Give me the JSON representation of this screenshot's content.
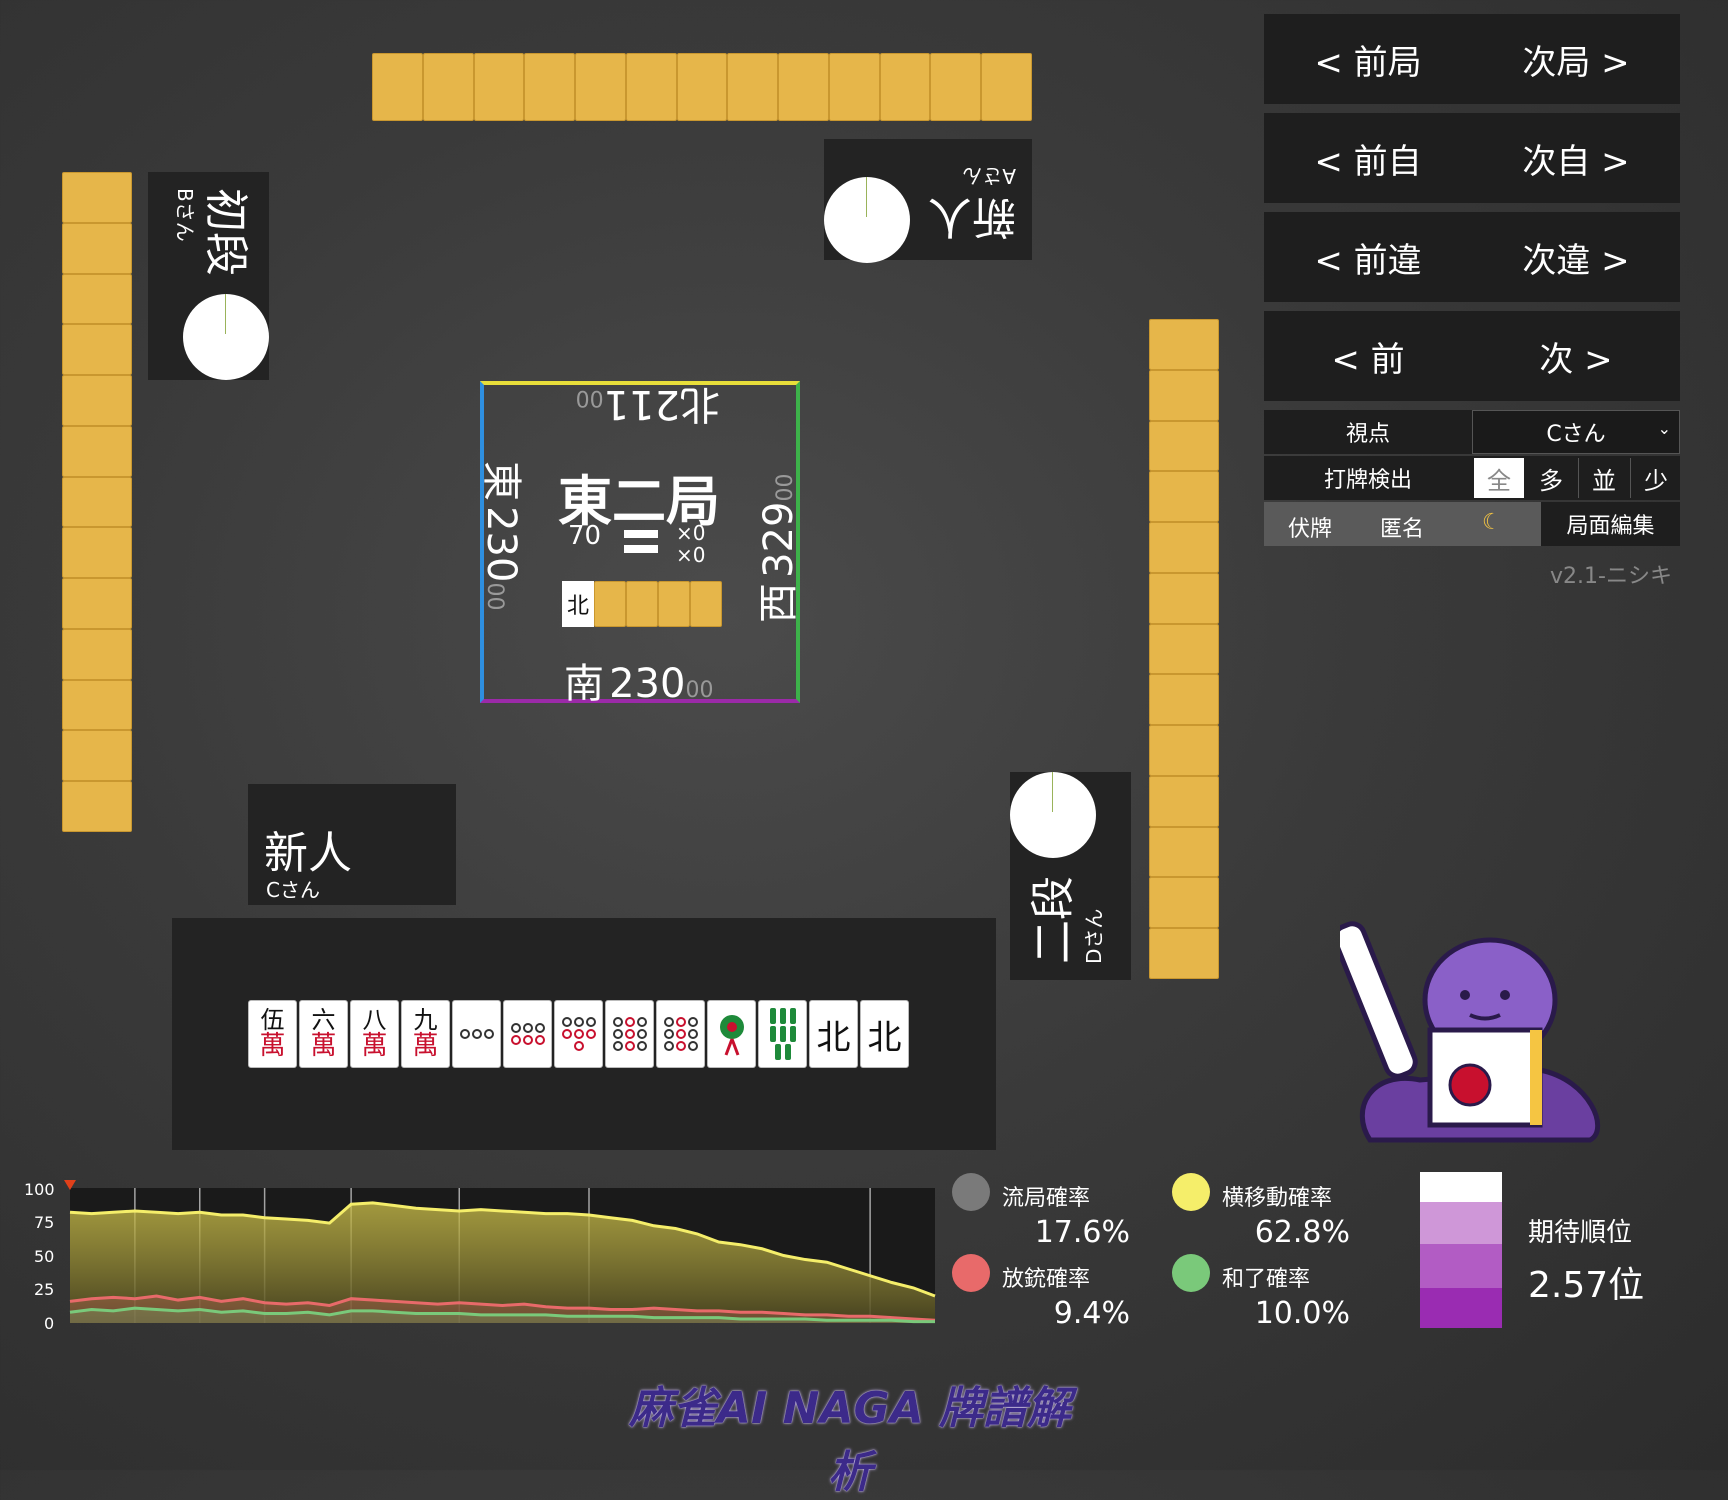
{
  "players": {
    "north": {
      "rank": "新人",
      "name": "Aさん"
    },
    "west": {
      "rank": "初段",
      "name": "Bさん"
    },
    "self": {
      "rank": "新人",
      "name": "Cさん"
    },
    "east": {
      "rank": "二段",
      "name": "Dさん"
    }
  },
  "center": {
    "round": "東二局",
    "honba_count": "70",
    "kyotaku": "×0",
    "riichi": "×0",
    "dora_indicator": "北",
    "scores": {
      "top": {
        "wind": "北",
        "value": "211",
        "sub": "00"
      },
      "left": {
        "wind": "東",
        "value": "230",
        "sub": "00"
      },
      "right": {
        "wind": "西",
        "value": "329",
        "sub": "00"
      },
      "bottom": {
        "wind": "南",
        "value": "230",
        "sub": "00"
      }
    }
  },
  "hand": [
    {
      "type": "man",
      "top": "伍",
      "bottom": "萬"
    },
    {
      "type": "man",
      "top": "六",
      "bottom": "萬"
    },
    {
      "type": "man",
      "top": "八",
      "bottom": "萬"
    },
    {
      "type": "man",
      "top": "九",
      "bottom": "萬"
    },
    {
      "type": "pin",
      "count": 3,
      "icon": "pin-3-icon"
    },
    {
      "type": "pin",
      "count": 6,
      "icon": "pin-6-icon"
    },
    {
      "type": "pin",
      "count": 7,
      "icon": "pin-7-icon"
    },
    {
      "type": "pin",
      "count": 9,
      "icon": "pin-9-icon"
    },
    {
      "type": "pin",
      "count": 9,
      "icon": "pin-9-icon"
    },
    {
      "type": "sou",
      "count": 1,
      "icon": "peacock-icon"
    },
    {
      "type": "sou",
      "count": 8,
      "icon": "sou-8-icon"
    },
    {
      "type": "honor",
      "label": "北"
    },
    {
      "type": "honor",
      "label": "北"
    }
  ],
  "nav": {
    "prev_round": "< 前局",
    "next_round": "次局 >",
    "prev_self": "< 前自",
    "next_self": "次自 >",
    "prev_diff": "< 前違",
    "next_diff": "次違 >",
    "prev": "< 前",
    "next": "次 >"
  },
  "options": {
    "viewpoint_label": "視点",
    "viewpoint_value": "Cさん",
    "detect_label": "打牌検出",
    "detect_options": [
      "全",
      "多",
      "並",
      "少"
    ],
    "hide_tiles": "伏牌",
    "anonymous": "匿名",
    "moon_icon": "moon-icon",
    "edit": "局面編集",
    "version": "v2.1-ニシキ"
  },
  "legend": {
    "ryukyoku": {
      "label": "流局確率",
      "value": "17.6%",
      "color": "#7a7a7a"
    },
    "yokoido": {
      "label": "横移動確率",
      "value": "62.8%",
      "color": "#f5ee6a"
    },
    "houju": {
      "label": "放銃確率",
      "value": "9.4%",
      "color": "#e86a6a"
    },
    "hora": {
      "label": "和了確率",
      "value": "10.0%",
      "color": "#7ac97a"
    },
    "expected_rank_label": "期待順位",
    "expected_rank_value": "2.57位"
  },
  "footer": {
    "title": "麻雀AI NAGA 牌譜解析"
  },
  "chart_data": {
    "type": "area",
    "y_ticks": [
      "100",
      "75",
      "50",
      "25",
      "0"
    ],
    "ylim": [
      0,
      100
    ],
    "x": [
      0,
      1,
      2,
      3,
      4,
      5,
      6,
      7,
      8,
      9,
      10,
      11,
      12,
      13,
      14,
      15,
      16,
      17,
      18,
      19,
      20,
      21,
      22,
      23,
      24,
      25,
      26,
      27,
      28,
      29,
      30,
      31,
      32,
      33,
      34,
      35,
      36,
      37,
      38,
      39,
      40
    ],
    "series": [
      {
        "color": "#f5ee6a",
        "values": [
          82,
          81,
          82,
          83,
          82,
          81,
          82,
          80,
          80,
          78,
          77,
          76,
          74,
          88,
          89,
          87,
          85,
          84,
          83,
          84,
          83,
          82,
          81,
          81,
          80,
          78,
          76,
          72,
          70,
          66,
          60,
          58,
          55,
          50,
          47,
          45,
          40,
          35,
          30,
          26,
          20
        ]
      },
      {
        "color": "#e86a6a",
        "values": [
          16,
          18,
          19,
          18,
          20,
          17,
          19,
          16,
          18,
          15,
          14,
          15,
          13,
          18,
          17,
          16,
          15,
          14,
          15,
          14,
          13,
          14,
          12,
          11,
          11,
          10,
          10,
          11,
          10,
          9,
          9,
          8,
          8,
          7,
          6,
          6,
          5,
          5,
          4,
          3,
          2
        ]
      },
      {
        "color": "#7ac97a",
        "values": [
          8,
          10,
          9,
          11,
          10,
          9,
          10,
          8,
          9,
          7,
          7,
          8,
          6,
          9,
          9,
          8,
          7,
          7,
          7,
          6,
          6,
          6,
          6,
          5,
          5,
          5,
          5,
          4,
          4,
          4,
          4,
          3,
          3,
          3,
          3,
          2,
          2,
          2,
          2,
          1,
          1
        ]
      }
    ]
  }
}
